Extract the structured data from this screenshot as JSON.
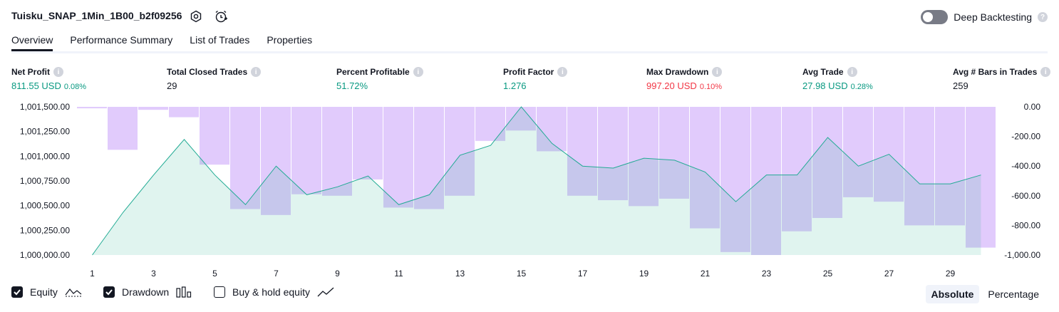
{
  "header": {
    "title": "Tuisku_SNAP_1Min_1B00_b2f09256",
    "deep_backtesting_label": "Deep Backtesting",
    "help_glyph": "?"
  },
  "tabs": [
    {
      "label": "Overview",
      "active": true
    },
    {
      "label": "Performance Summary",
      "active": false
    },
    {
      "label": "List of Trades",
      "active": false
    },
    {
      "label": "Properties",
      "active": false
    }
  ],
  "metrics": {
    "net_profit": {
      "label": "Net Profit",
      "value": "811.55 USD",
      "pct": "0.08%"
    },
    "closed_trades": {
      "label": "Total Closed Trades",
      "value": "29"
    },
    "percent_profitable": {
      "label": "Percent Profitable",
      "value": "51.72%"
    },
    "profit_factor": {
      "label": "Profit Factor",
      "value": "1.276"
    },
    "max_drawdown": {
      "label": "Max Drawdown",
      "value": "997.20 USD",
      "pct": "0.10%"
    },
    "avg_trade": {
      "label": "Avg Trade",
      "value": "27.98 USD",
      "pct": "0.28%"
    },
    "avg_bars": {
      "label": "Avg # Bars in Trades",
      "value": "259"
    }
  },
  "legend": {
    "equity_label": "Equity",
    "drawdown_label": "Drawdown",
    "buy_hold_label": "Buy & hold equity",
    "equity_checked": true,
    "drawdown_checked": true,
    "buy_hold_checked": false,
    "absolute_label": "Absolute",
    "percentage_label": "Percentage",
    "selected_mode": "Absolute"
  },
  "colors": {
    "equity_line": "#22ab94",
    "equity_fill": "#e1f4ee",
    "drawdown_fill": "#dcc2fb",
    "positive": "#089981",
    "negative": "#f23645"
  },
  "chart_data": {
    "type": "area",
    "x": [
      1,
      2,
      3,
      4,
      5,
      6,
      7,
      8,
      9,
      10,
      11,
      12,
      13,
      14,
      15,
      16,
      17,
      18,
      19,
      20,
      21,
      22,
      23,
      24,
      25,
      26,
      27,
      28,
      29,
      30
    ],
    "x_ticks": [
      "1",
      "3",
      "5",
      "7",
      "9",
      "11",
      "13",
      "15",
      "17",
      "19",
      "21",
      "23",
      "25",
      "27",
      "29"
    ],
    "y_left_ticks": [
      "1,001,500.00",
      "1,001,250.00",
      "1,001,000.00",
      "1,000,750.00",
      "1,000,500.00",
      "1,000,250.00",
      "1,000,000.00"
    ],
    "y_right_ticks": [
      "0.00",
      "-200.00",
      "-400.00",
      "-600.00",
      "-800.00",
      "-1,000.00"
    ],
    "ylim_left": [
      1000000,
      1001500
    ],
    "ylim_right": [
      -1000,
      0
    ],
    "series": [
      {
        "name": "Equity",
        "values": [
          1000000,
          1000430,
          1000810,
          1001170,
          1000810,
          1000510,
          1000900,
          1000610,
          1000690,
          1000800,
          1000510,
          1000610,
          1001010,
          1001110,
          1001500,
          1001130,
          1000900,
          1000880,
          1000980,
          1000960,
          1000840,
          1000540,
          1000810,
          1000810,
          1001190,
          1000900,
          1001020,
          1000720,
          1000720,
          1000810
        ]
      },
      {
        "name": "Drawdown",
        "values": [
          -10,
          -290,
          -20,
          -70,
          -390,
          -690,
          -730,
          -590,
          -600,
          -490,
          -680,
          -690,
          -600,
          -230,
          -160,
          -300,
          -600,
          -630,
          -670,
          -620,
          -820,
          -980,
          -1000,
          -840,
          -750,
          -610,
          -640,
          -800,
          -800,
          -950
        ]
      }
    ]
  }
}
